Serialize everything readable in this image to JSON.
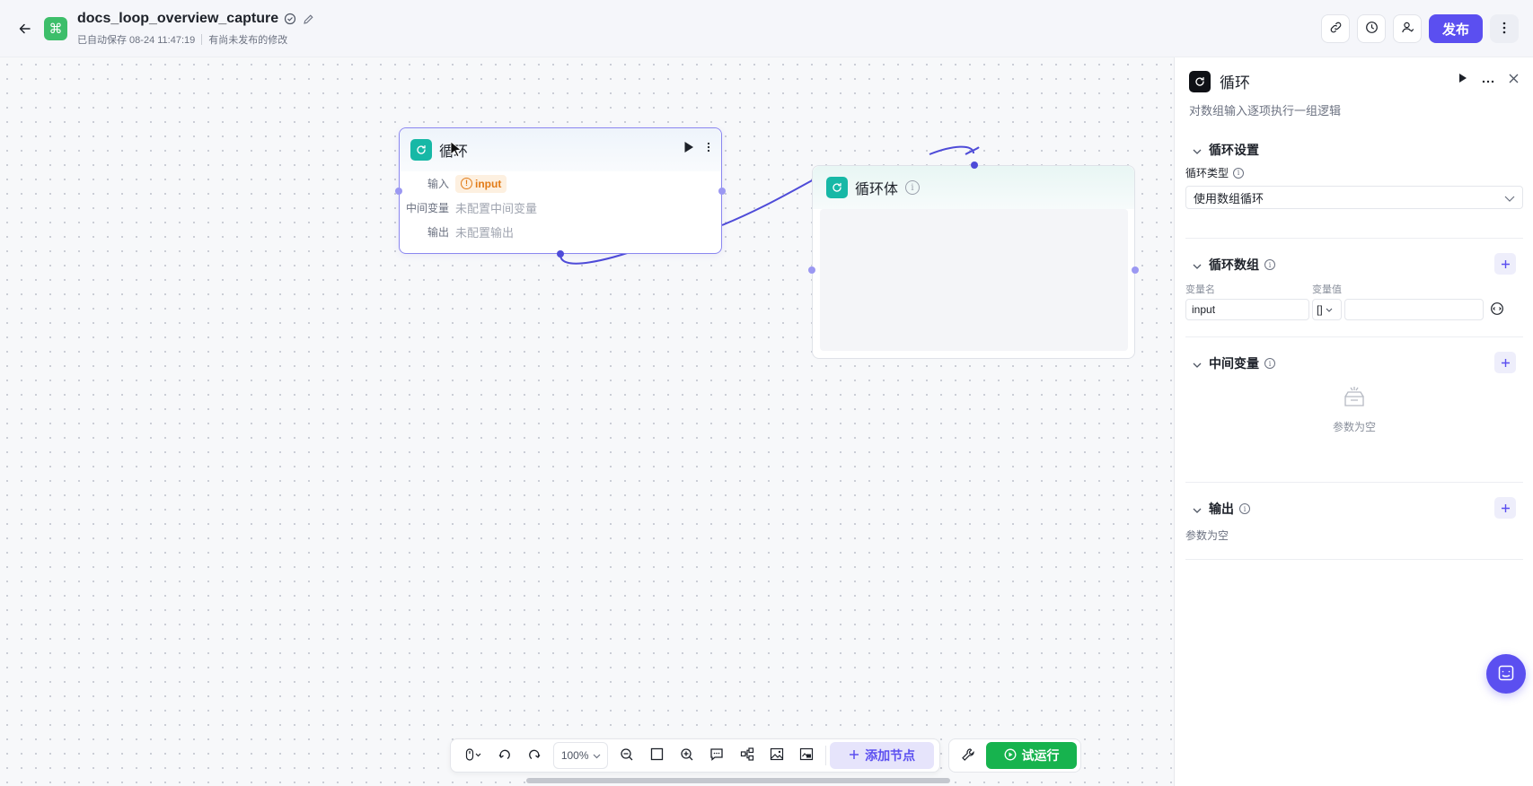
{
  "header": {
    "title": "docs_loop_overview_capture",
    "autosave": "已自动保存 08-24 11:47:19",
    "unpublished": "有尚未发布的修改",
    "publish_label": "发布"
  },
  "canvas": {
    "loop_node": {
      "title": "循环",
      "input_label": "输入",
      "input_value": "input",
      "intermediate_label": "中间变量",
      "intermediate_value": "未配置中间变量",
      "output_label": "输出",
      "output_value": "未配置输出"
    },
    "body_node": {
      "title": "循环体"
    }
  },
  "toolbar": {
    "zoom": "100%",
    "add_node_label": "添加节点",
    "run_label": "试运行"
  },
  "panel": {
    "title": "循环",
    "description": "对数组输入逐项执行一组逻辑",
    "settings": {
      "title": "循环设置",
      "type_label": "循环类型",
      "type_value": "使用数组循环"
    },
    "array": {
      "title": "循环数组",
      "name_header": "变量名",
      "value_header": "变量值",
      "name_value": "input",
      "type_badge": "[]"
    },
    "intermediate": {
      "title": "中间变量",
      "empty": "参数为空"
    },
    "output": {
      "title": "输出",
      "empty": "参数为空"
    }
  },
  "colors": {
    "accent": "#5b4ff0",
    "run_green": "#17b34e",
    "node_teal": "#17b8a6",
    "warning": "#e27b17"
  }
}
